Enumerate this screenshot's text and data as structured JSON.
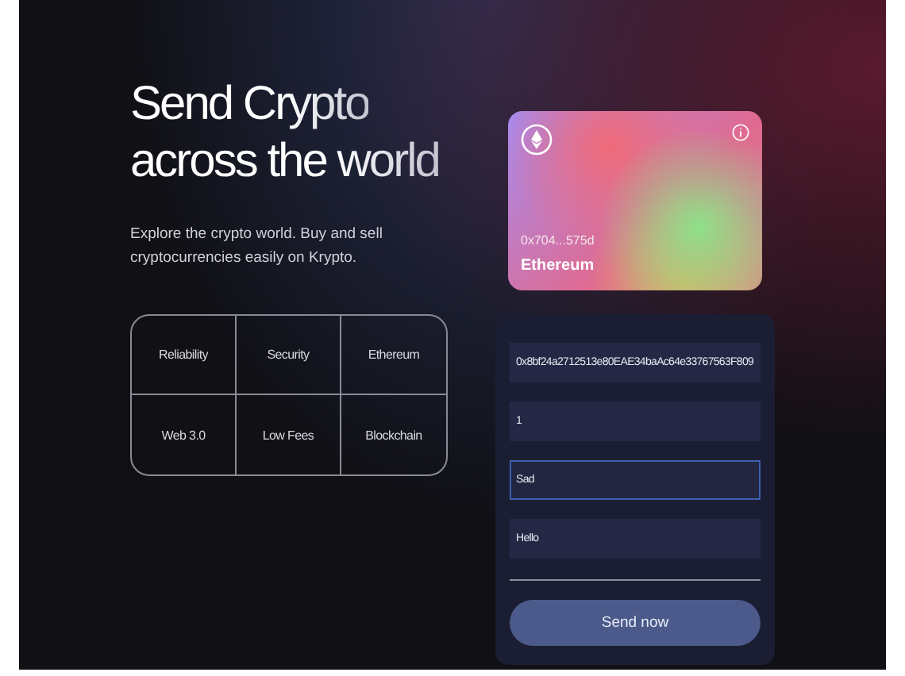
{
  "hero": {
    "title_lines": [
      "Send Crypto",
      "across the world"
    ],
    "subtitle": "Explore the crypto world. Buy and sell cryptocurrencies easily on Krypto."
  },
  "features": [
    "Reliability",
    "Security",
    "Ethereum",
    "Web 3.0",
    "Low Fees",
    "Blockchain"
  ],
  "card": {
    "address": "0x704...575d",
    "network": "Ethereum"
  },
  "form": {
    "inputs": [
      {
        "value": "0x8bf24a2712513e80EAE34baAc64e33767563F809",
        "focused": false
      },
      {
        "value": "1",
        "focused": false
      },
      {
        "value": "Sad",
        "focused": true
      },
      {
        "value": "Hello",
        "focused": false
      }
    ],
    "button": "Send now"
  }
}
